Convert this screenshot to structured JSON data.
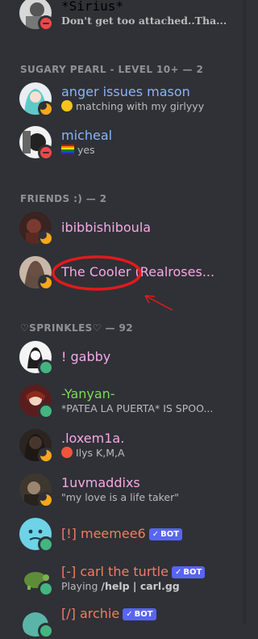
{
  "colors": {
    "background": "#2f3136",
    "section_header": "#8e9297",
    "subtext": "#b9bbbe",
    "annotation_red": "#e3191c",
    "bot_badge": "#5865f2"
  },
  "members_top": [
    {
      "name": "*Sirius*",
      "sub": "Don't get too attached..Tha...",
      "status": "dnd",
      "name_color": "#8e9297"
    }
  ],
  "sections": [
    {
      "header": "SUGARY PEARL - LEVEL 10+ — 2",
      "members": [
        {
          "name": "anger issues mason",
          "sub": "matching with my girlyyy",
          "status": "idle",
          "name_color": "#8ab4f8",
          "sub_icon": "heart-eyes-emoji-icon"
        },
        {
          "name": "micheal",
          "sub": "yes",
          "status": "dnd",
          "name_color": "#8ab4f8",
          "sub_icon": "rainbow-flag-icon"
        }
      ]
    },
    {
      "header": "FRIENDS :) — 2",
      "members": [
        {
          "name": "ibibbishiboula",
          "sub": "",
          "status": "idle",
          "name_color": "#f7a8e6"
        },
        {
          "name": "The Cooler (Realroses...",
          "sub": "",
          "status": "idle",
          "name_color": "#f7a8e6"
        }
      ]
    },
    {
      "header": "♡SPRINKLES♡ — 92",
      "members": [
        {
          "name": "! gabby",
          "sub": "",
          "status": "online",
          "name_color": "#f7a8e6"
        },
        {
          "name": "-Yanyan-",
          "sub": "*PATEA LA PUERTA* IS SPOO...",
          "status": "online",
          "name_color": "#7ed957"
        },
        {
          "name": ".loxem1a.",
          "sub": "Ilys K,M,A",
          "status": "idle",
          "name_color": "#f7a8e6",
          "sub_icon": "heart-on-fire-emoji-icon"
        },
        {
          "name": "1uvmaddixs",
          "sub": "\"my love is a life taker\"",
          "status": "idle",
          "name_color": "#f7a8e6"
        },
        {
          "name": "[!] meemee6",
          "sub": "",
          "status": "online",
          "name_color": "#f47b67",
          "bot": "BOT"
        },
        {
          "name": "[-] carl the turtle",
          "sub_prefix": "Playing ",
          "sub": "/help | carl.gg",
          "status": "online",
          "name_color": "#f47b67",
          "bot": "BOT"
        },
        {
          "name": "[/] archie",
          "sub": "",
          "status": "online",
          "name_color": "#f47b67",
          "bot": "BOT"
        }
      ]
    }
  ]
}
